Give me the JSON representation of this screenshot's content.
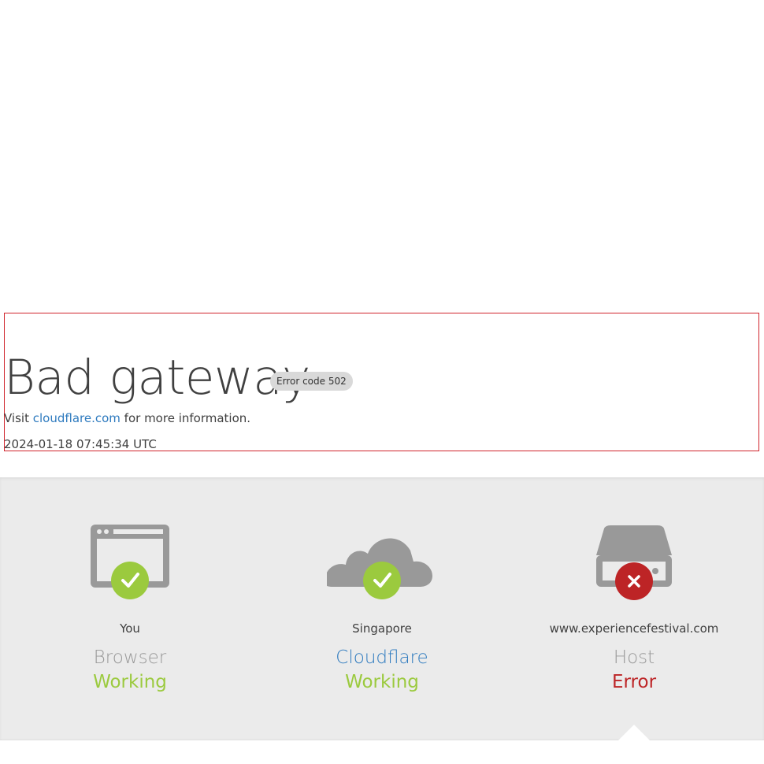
{
  "page": {
    "title": "Bad gateway",
    "error_badge": "Error code 502",
    "visit_prefix": "Visit",
    "visit_link": "cloudflare.com",
    "visit_suffix": "for more information.",
    "timestamp": "2024-01-18 07:45:34 UTC"
  },
  "status": [
    {
      "location": "You",
      "service": "Browser",
      "state": "Working",
      "icon": "browser-icon",
      "status_icon": "check-icon",
      "status_color": "#9bca3e"
    },
    {
      "location": "Singapore",
      "service": "Cloudflare",
      "state": "Working",
      "icon": "cloud-icon",
      "status_icon": "check-icon",
      "status_color": "#9bca3e"
    },
    {
      "location": "www.experiencefestival.com",
      "service": "Host",
      "state": "Error",
      "icon": "server-icon",
      "status_icon": "error-x-icon",
      "status_color": "#bd2426"
    }
  ],
  "colors": {
    "link": "#2f7bbf",
    "ok": "#9bca3e",
    "error": "#bd2426",
    "icon_gray": "#999999",
    "panel_bg": "#ebebeb"
  }
}
